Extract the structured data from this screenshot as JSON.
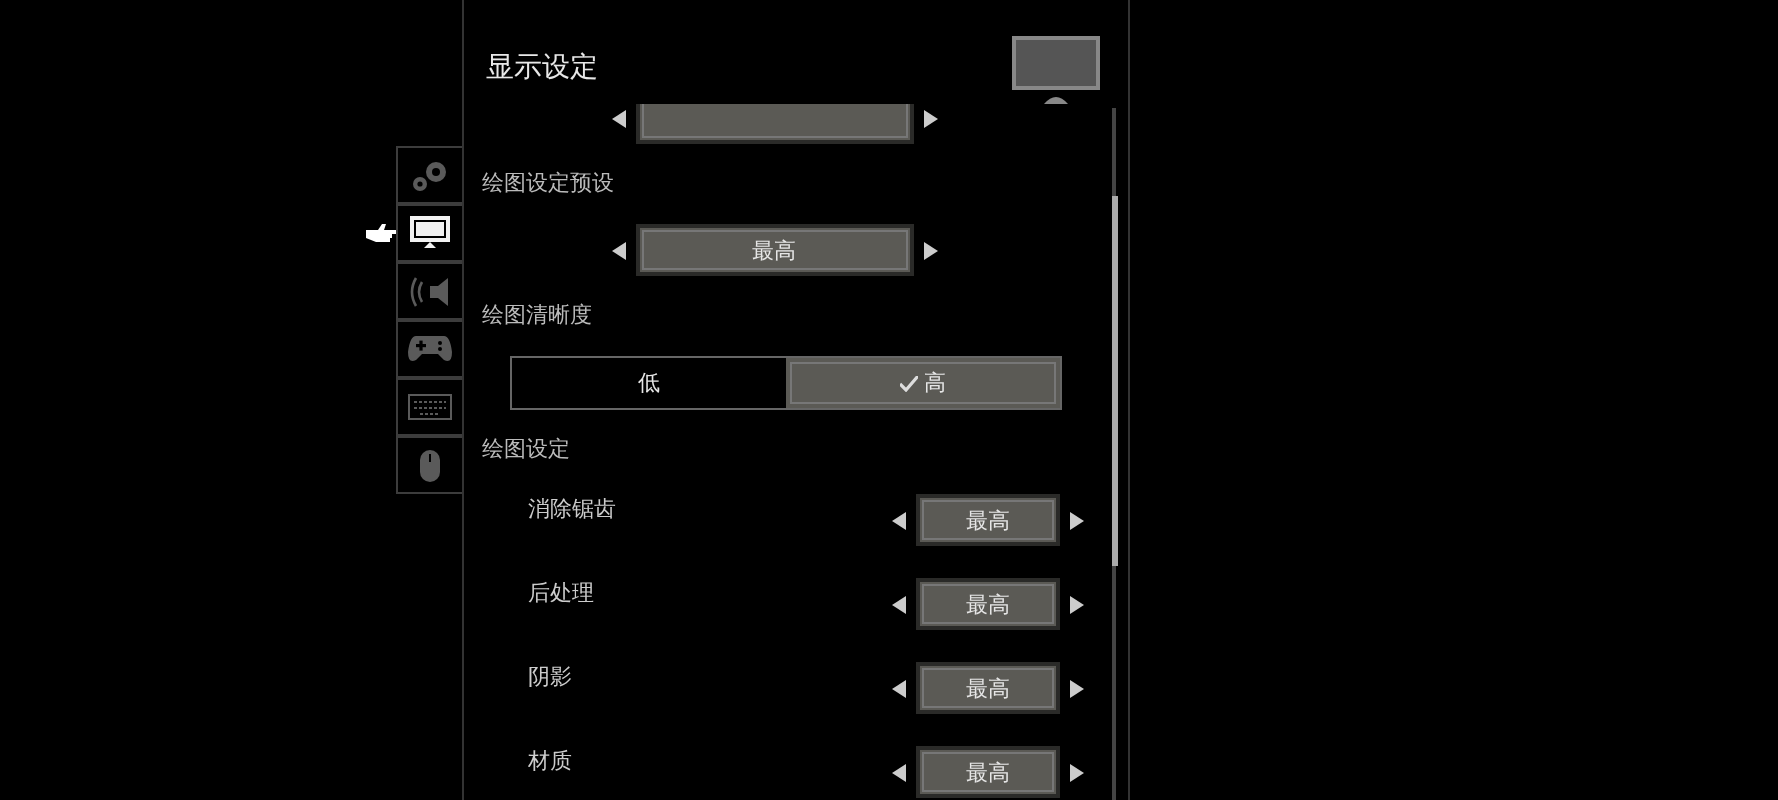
{
  "title": "显示设定",
  "tabs": [
    {
      "selected": false
    },
    {
      "selected": true
    },
    {
      "selected": false
    },
    {
      "selected": false
    },
    {
      "selected": false
    },
    {
      "selected": false
    }
  ],
  "sections": [
    {
      "kind": "cut_selector"
    },
    {
      "kind": "heading",
      "label": "绘图设定预设"
    },
    {
      "kind": "selector",
      "value": "最高"
    },
    {
      "kind": "heading",
      "label": "绘图清晰度"
    },
    {
      "kind": "toggle",
      "options": [
        {
          "label": "低",
          "selected": false
        },
        {
          "label": "高",
          "selected": true
        }
      ]
    },
    {
      "kind": "heading",
      "label": "绘图设定"
    },
    {
      "kind": "row",
      "label": "消除锯齿",
      "value": "最高"
    },
    {
      "kind": "row",
      "label": "后处理",
      "value": "最高"
    },
    {
      "kind": "row",
      "label": "阴影",
      "value": "最高"
    },
    {
      "kind": "row",
      "label": "材质",
      "value": "最高"
    }
  ]
}
